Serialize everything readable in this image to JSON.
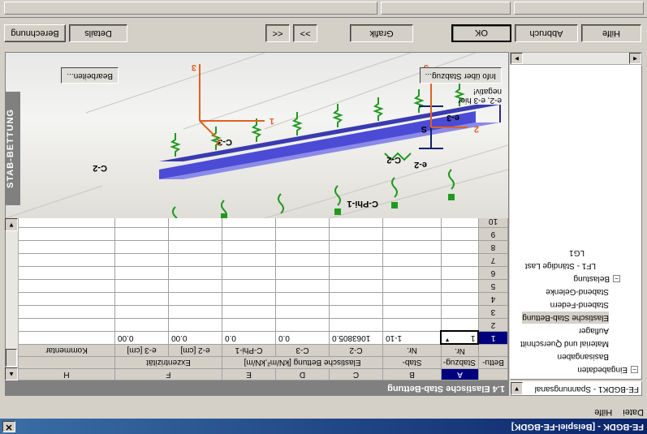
{
  "window": {
    "title": "FE-BGDK - [Beispiel-FE-BGDK]",
    "close_glyph": "✕"
  },
  "menu": [
    "Datei",
    "Hilfe"
  ],
  "combo": {
    "value": "FE-BGDK1 - Spannungsanal"
  },
  "tree": [
    {
      "label": "Eingabedaten",
      "expander": "−"
    },
    {
      "label": "Basisangaben"
    },
    {
      "label": "Material und Querschnitt"
    },
    {
      "label": "Auflager"
    },
    {
      "label": "Elastische Stab-Bettung",
      "selected": true
    },
    {
      "label": "Stabend-Federn"
    },
    {
      "label": "Stabend-Gelenke"
    },
    {
      "label": "Belastung",
      "expander": "−"
    },
    {
      "label": "LF1 - Ständige Last"
    },
    {
      "label": "LG1"
    }
  ],
  "section": {
    "title": "1.4 Elastische Stab-Bettung"
  },
  "table": {
    "col_letters": [
      "A",
      "B",
      "C",
      "D",
      "E",
      "F",
      "G",
      "H"
    ],
    "header_top": {
      "c_to_e": "Elastische Bettung [kN/m²,kN/m]",
      "f_to_g": "Exzentrizität"
    },
    "headers_1": [
      "Bettu-",
      "Stabzug-",
      "Stab-",
      "C-2",
      "C-3",
      "C-Phi-1",
      "e-2 [cm]",
      "e-3 [cm]",
      "Kommentar"
    ],
    "headers_2": [
      "",
      "Nr.",
      "Nr.",
      "",
      "",
      "",
      "",
      "",
      ""
    ],
    "rows": [
      {
        "n": "1",
        "stabzug": "1",
        "stab": "1-10",
        "c2": "1063805.0",
        "c3": "0.0",
        "cphi": "0.0",
        "e2": "0.00",
        "e3": "0.00",
        "komm": ""
      },
      {
        "n": "2"
      },
      {
        "n": "3"
      },
      {
        "n": "4"
      },
      {
        "n": "5"
      },
      {
        "n": "6"
      },
      {
        "n": "7"
      },
      {
        "n": "8"
      },
      {
        "n": "9"
      },
      {
        "n": "10"
      }
    ]
  },
  "graphic": {
    "side_label": "STAB-BETTUNG",
    "labels": {
      "c3": "C-3",
      "c2_left": "C-2",
      "c2_right": "C-2",
      "cphi": "C-Phi-1",
      "ax1": "1",
      "ax2": "2",
      "ax3": "3",
      "ax2r": "2",
      "ax3r": "3",
      "s": "S",
      "e2": "e-2",
      "e3": "e-3"
    },
    "note": "e-2, e-3 hier negativ!",
    "buttons": {
      "info": "Info über Stabzug...",
      "edit": "Bearbeiten..."
    }
  },
  "buttons": {
    "calc": "Berechnung",
    "details": "Details",
    "prev": "<<",
    "next": ">>",
    "graphic": "Grafik",
    "ok": "OK",
    "cancel": "Abbruch",
    "help": "Hilfe"
  },
  "colors": {
    "active": "#00007f",
    "beam": "#4b4bd6",
    "spring": "#1f9a1f"
  }
}
